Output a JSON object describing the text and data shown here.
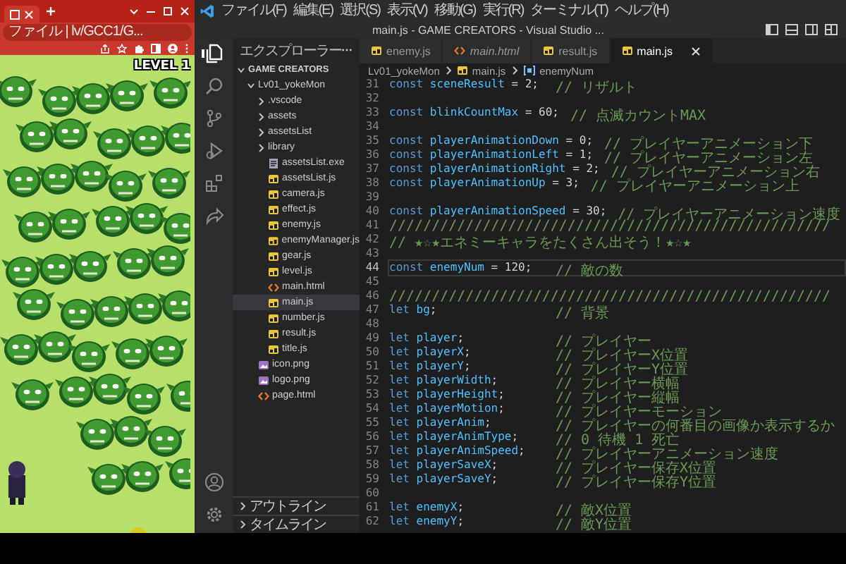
{
  "browser": {
    "address": "ファイル | lv/GCC1/G...",
    "level_label": "LEVEL 1"
  },
  "vscode": {
    "menu": [
      "ファイル(F)",
      "編集(E)",
      "選択(S)",
      "表示(V)",
      "移動(G)",
      "実行(R)",
      "ターミナル(T)",
      "ヘルプ(H)"
    ],
    "title": "main.js - GAME CREATORS - Visual Studio ...",
    "activity_bar": {
      "top": [
        {
          "kind": "files",
          "selected": true
        },
        {
          "kind": "search",
          "selected": false
        },
        {
          "kind": "source-control",
          "selected": false
        },
        {
          "kind": "run",
          "selected": false
        },
        {
          "kind": "extensions",
          "selected": false
        },
        {
          "kind": "remote",
          "selected": false
        }
      ],
      "bottom": [
        {
          "kind": "account"
        },
        {
          "kind": "settings"
        }
      ]
    },
    "explorer": {
      "title": "エクスプローラー",
      "tree": [
        {
          "kind": "folder",
          "label": "GAME CREATORS",
          "expanded": true,
          "selected": false,
          "children": [
            {
              "kind": "folder",
              "label": "Lv01_yokeMon",
              "expanded": true,
              "selected": false,
              "children": [
                {
                  "kind": "folder",
                  "label": ".vscode",
                  "expanded": false,
                  "selected": false
                },
                {
                  "kind": "folder",
                  "label": "assets",
                  "expanded": false,
                  "selected": false
                },
                {
                  "kind": "folder",
                  "label": "assetsList",
                  "expanded": false,
                  "selected": false
                },
                {
                  "kind": "folder",
                  "label": "library",
                  "expanded": false,
                  "selected": false
                },
                {
                  "kind": "exe",
                  "label": "assetsList.exe",
                  "selected": false
                },
                {
                  "kind": "js",
                  "label": "assetsList.js",
                  "selected": false
                },
                {
                  "kind": "js",
                  "label": "camera.js",
                  "selected": false
                },
                {
                  "kind": "js",
                  "label": "effect.js",
                  "selected": false
                },
                {
                  "kind": "js",
                  "label": "enemy.js",
                  "selected": false
                },
                {
                  "kind": "js",
                  "label": "enemyManager.js",
                  "selected": false
                },
                {
                  "kind": "js",
                  "label": "gear.js",
                  "selected": false
                },
                {
                  "kind": "js",
                  "label": "level.js",
                  "selected": false
                },
                {
                  "kind": "html",
                  "label": "main.html",
                  "selected": false
                },
                {
                  "kind": "js",
                  "label": "main.js",
                  "selected": true
                },
                {
                  "kind": "js",
                  "label": "number.js",
                  "selected": false
                },
                {
                  "kind": "js",
                  "label": "result.js",
                  "selected": false
                },
                {
                  "kind": "js",
                  "label": "title.js",
                  "selected": false
                }
              ]
            },
            {
              "kind": "image",
              "label": "icon.png",
              "selected": false
            },
            {
              "kind": "image",
              "label": "logo.png",
              "selected": false
            },
            {
              "kind": "html",
              "label": "page.html",
              "selected": false
            }
          ]
        }
      ],
      "sections": [
        {
          "label": "アウトライン",
          "expanded": false
        },
        {
          "label": "タイムライン",
          "expanded": false
        }
      ]
    },
    "tabs": [
      {
        "kind": "js",
        "label": "enemy.js",
        "selected": false,
        "preview": false
      },
      {
        "kind": "html",
        "label": "main.html",
        "selected": false,
        "preview": true
      },
      {
        "kind": "js",
        "label": "result.js",
        "selected": false,
        "preview": false
      },
      {
        "kind": "js",
        "label": "main.js",
        "selected": true,
        "preview": false
      }
    ],
    "breadcrumb": [
      {
        "kind": "folder",
        "label": "Lv01_yokeMon"
      },
      {
        "kind": "js",
        "label": "main.js"
      },
      {
        "kind": "variable",
        "label": "enemyNum"
      }
    ],
    "code_lines": [
      {
        "n": "31",
        "kind": "code",
        "keyword": "const",
        "name": "sceneResult",
        "rest": " = 2;",
        "comment": "// リザルト",
        "current": false
      },
      {
        "n": "32",
        "kind": "blank",
        "current": false
      },
      {
        "n": "33",
        "kind": "code",
        "keyword": "const",
        "name": "blinkCountMax",
        "rest": " = 60;",
        "comment": "// 点滅カウントMAX",
        "current": false
      },
      {
        "n": "34",
        "kind": "blank",
        "current": false
      },
      {
        "n": "35",
        "kind": "code",
        "keyword": "const",
        "name": "playerAnimationDown",
        "rest": " = 0;",
        "comment": "// プレイヤーアニメーション下",
        "current": false
      },
      {
        "n": "36",
        "kind": "code",
        "keyword": "const",
        "name": "playerAnimationLeft",
        "rest": " = 1;",
        "comment": "// プレイヤーアニメーション左",
        "current": false
      },
      {
        "n": "37",
        "kind": "code",
        "keyword": "const",
        "name": "playerAnimationRight",
        "rest": " = 2;",
        "comment": "// プレイヤーアニメーション右",
        "current": false
      },
      {
        "n": "38",
        "kind": "code",
        "keyword": "const",
        "name": "playerAnimationUp",
        "rest": " = 3;",
        "comment": "// プレイヤーアニメーション上",
        "current": false
      },
      {
        "n": "39",
        "kind": "blank",
        "current": false
      },
      {
        "n": "40",
        "kind": "code",
        "keyword": "const",
        "name": "playerAnimationSpeed",
        "rest": " = 30;",
        "comment": "// プレイヤーアニメーション速度",
        "current": false
      },
      {
        "n": "41",
        "kind": "comment",
        "text": "////////////////////////////////////////////////////",
        "current": false
      },
      {
        "n": "42",
        "kind": "comment",
        "text": "// ★☆★エネミーキャラをたくさん出そう！★☆★",
        "current": false
      },
      {
        "n": "43",
        "kind": "blank",
        "current": false
      },
      {
        "n": "44",
        "kind": "code",
        "keyword": "const",
        "name": "enemyNum",
        "rest": " = 120;",
        "comment": "// 敵の数",
        "current": true
      },
      {
        "n": "45",
        "kind": "blank",
        "current": false
      },
      {
        "n": "46",
        "kind": "comment",
        "text": "////////////////////////////////////////////////////",
        "current": false
      },
      {
        "n": "47",
        "kind": "code",
        "keyword": "let",
        "name": "bg",
        "rest": ";",
        "comment": "// 背景",
        "current": false
      },
      {
        "n": "48",
        "kind": "blank",
        "current": false
      },
      {
        "n": "49",
        "kind": "code",
        "keyword": "let",
        "name": "player",
        "rest": ";",
        "comment": "// プレイヤー",
        "current": false
      },
      {
        "n": "50",
        "kind": "code",
        "keyword": "let",
        "name": "playerX",
        "rest": ";",
        "comment": "// プレイヤーX位置",
        "current": false
      },
      {
        "n": "51",
        "kind": "code",
        "keyword": "let",
        "name": "playerY",
        "rest": ";",
        "comment": "// プレイヤーY位置",
        "current": false
      },
      {
        "n": "52",
        "kind": "code",
        "keyword": "let",
        "name": "playerWidth",
        "rest": ";",
        "comment": "// プレイヤー横幅",
        "current": false
      },
      {
        "n": "53",
        "kind": "code",
        "keyword": "let",
        "name": "playerHeight",
        "rest": ";",
        "comment": "// プレイヤー縦幅",
        "current": false
      },
      {
        "n": "54",
        "kind": "code",
        "keyword": "let",
        "name": "playerMotion",
        "rest": ";",
        "comment": "// プレイヤーモーション",
        "current": false
      },
      {
        "n": "55",
        "kind": "code",
        "keyword": "let",
        "name": "playerAnim",
        "rest": ";",
        "comment": "// プレイヤーの何番目の画像か表示するか",
        "current": false
      },
      {
        "n": "56",
        "kind": "code",
        "keyword": "let",
        "name": "playerAnimType",
        "rest": ";",
        "comment": "// 0 待機 1 死亡",
        "current": false
      },
      {
        "n": "57",
        "kind": "code",
        "keyword": "let",
        "name": "playerAnimSpeed",
        "rest": ";",
        "comment": "// プレイヤーアニメーション速度",
        "current": false
      },
      {
        "n": "58",
        "kind": "code",
        "keyword": "let",
        "name": "playerSaveX",
        "rest": ";",
        "comment": "// プレイヤー保存X位置",
        "current": false
      },
      {
        "n": "59",
        "kind": "code",
        "keyword": "let",
        "name": "playerSaveY",
        "rest": ";",
        "comment": "// プレイヤー保存Y位置",
        "current": false
      },
      {
        "n": "60",
        "kind": "blank",
        "current": false
      },
      {
        "n": "61",
        "kind": "code",
        "keyword": "let",
        "name": "enemyX",
        "rest": ";",
        "comment": "// 敵X位置",
        "current": false
      },
      {
        "n": "62",
        "kind": "code",
        "keyword": "let",
        "name": "enemyY",
        "rest": ";",
        "comment": "// 敵Y位置",
        "current": false
      }
    ]
  }
}
